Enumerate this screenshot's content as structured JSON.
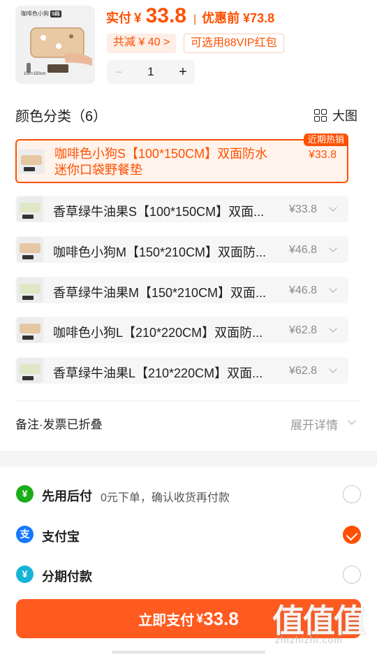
{
  "header": {
    "image_brand": "咖啡色小狗",
    "image_size_badge": "S码",
    "image_size_text": "100×150cm",
    "price_label": "实付",
    "currency": "¥",
    "price_amount": "33.8",
    "separator": "|",
    "original_label": "优惠前 ¥73.8",
    "discount_tag": "共减 ¥ 40 >",
    "vip_tag": "可选用88VIP红包",
    "stepper": {
      "minus": "−",
      "quantity": "1",
      "plus": "+"
    }
  },
  "variants": {
    "title": "颜色分类（6）",
    "big_view_label": "大图",
    "items": [
      {
        "label": "咖啡色小狗S【100*150CM】双面防水",
        "label2": "迷你口袋野餐垫",
        "price": "¥33.8",
        "badge": "近期热销",
        "selected": true,
        "tone": "brown"
      },
      {
        "label": "香草绿牛油果S【100*150CM】双面...",
        "price": "¥33.8",
        "selected": false,
        "tone": "green"
      },
      {
        "label": "咖啡色小狗M【150*210CM】双面防...",
        "price": "¥46.8",
        "selected": false,
        "tone": "brown"
      },
      {
        "label": "香草绿牛油果M【150*210CM】双面...",
        "price": "¥46.8",
        "selected": false,
        "tone": "green"
      },
      {
        "label": "咖啡色小狗L【210*220CM】双面防...",
        "price": "¥62.8",
        "selected": false,
        "tone": "brown"
      },
      {
        "label": "香草绿牛油果L【210*220CM】双面...",
        "price": "¥62.8",
        "selected": false,
        "tone": "green"
      }
    ]
  },
  "remark": {
    "label": "备注·发票已折叠",
    "expand_label": "展开详情"
  },
  "payment": {
    "options": [
      {
        "icon": "paylater-icon",
        "glyph": "¥",
        "color": "#1aad19",
        "name": "先用后付",
        "desc": "0元下单，确认收货再付款",
        "checked": false
      },
      {
        "icon": "alipay-icon",
        "glyph": "支",
        "color": "#1677ff",
        "name": "支付宝",
        "desc": "",
        "checked": true
      },
      {
        "icon": "installment-icon",
        "glyph": "¥",
        "color": "#15b4d6",
        "name": "分期付款",
        "desc": "",
        "checked": false
      }
    ]
  },
  "pay_button": {
    "label": "立即支付",
    "currency": "¥",
    "amount": "33.8"
  },
  "watermark": {
    "main": "值值值",
    "sub": "zhizhizhi.com"
  },
  "colors": {
    "accent": "#ff5000",
    "button": "#ff5a1f",
    "selected_bg": "#fff3ec"
  }
}
